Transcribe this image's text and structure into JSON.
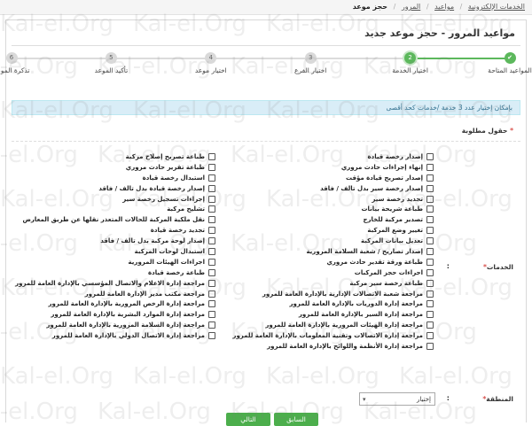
{
  "breadcrumb": {
    "home": "الخدمات الإلكترونية",
    "appointments": "مواعيد",
    "traffic": "المرور",
    "current": "حجز موعد"
  },
  "page_title": "مواعيد المرور - حجز موعد جديد",
  "wizard": {
    "steps": [
      {
        "number": "",
        "label": "المواعيد المتاحة",
        "state": "done"
      },
      {
        "number": "2",
        "label": "اختيار الخدمة",
        "state": "active"
      },
      {
        "number": "3",
        "label": "اختيار الفرع",
        "state": "pending"
      },
      {
        "number": "4",
        "label": "اختيار موعد",
        "state": "pending"
      },
      {
        "number": "5",
        "label": "تأكيد الموعد",
        "state": "pending"
      },
      {
        "number": "6",
        "label": "تذكرة الموعد",
        "state": "pending"
      }
    ],
    "accent": "#5cb85c"
  },
  "info_message": "بإمكان إختيار عدد 3 خدمة /خدمات كحد أقصى",
  "required_note": "حقول مطلوبة",
  "services_label": "الخدمات",
  "services_right": [
    "إصدار رخصة قيادة",
    "إنهاء إجراءات حادث مروري",
    "إصدار تصريح قيادة مؤقت",
    "إصدار رخصة سير بدل تالف / فاقد",
    "تجديد رخصة سير",
    "طباعة شريحة بيانات",
    "تصدير مركبة للخارج",
    "تغيير وضع المركبة",
    "تعديل بيانات المركبة",
    "إصدار تصاريح / شعبة السلامة المرورية",
    "طباعة ورقة تقدير حادث مروري",
    "اجراءات حجز المركبات",
    "طباعة رخصة سير مركبة",
    "مراجعة شعبة الاتصالات الإدارية بالإدارة العامة للمرور",
    "مراجعة إدارة الدوريات بالإدارة العامة للمرور",
    "مراجعة إدارة السير بالإدارة العامة للمرور",
    "مراجعة إدارة الهيئات المرورية بالإدارة العامة للمرور",
    "مراجعة إدارة الاتصالات وتقنية المعلومات بالإدارة العامة للمرور",
    "مراجعة إدارة الأنظمة واللوائح بالإدارة العامة للمرور"
  ],
  "services_left": [
    "طباعة تصريح إصلاح مركبة",
    "طباعة تقرير حادث مروري",
    "استبدال رخصة قيادة",
    "إصدار رخصة قيادة بدل تالف / فاقد",
    "إجراءات تسجيل رخصة سير",
    "تشليح مركبة",
    "نقل ملكية المركبة للحالات المتعذر نقلها عن طريق المعارض",
    "تجديد رخصة قيادة",
    "إصدار لوحة مركبة بدل تالف / فاقد",
    "استبدال لوحات المركبة",
    "اجراءات الهيئات المرورية",
    "طباعة رخصة قيادة",
    "مراجعة إدارة الاعلام والاتصال المؤسسي بالإدارة العامة للمرور",
    "مراجعة مكتب مدير الإدارة العامة للمرور",
    "مراجعة إدارة الرخص المرورية بالإدارة العامة للمرور",
    "مراجعة إدارة الموارد البشرية بالإدارة العامة للمرور",
    "مراجعة إدارة السلامة المرورية بالإدارة العامة للمرور",
    "مراجعة إدارة الاتصال الدولي بالإدارة العامة للمرور"
  ],
  "region": {
    "label": "المنطقة",
    "selected": "إختيار"
  },
  "buttons": {
    "prev": "السابق",
    "next": "التالي"
  },
  "watermark": "Kal-el.Org"
}
